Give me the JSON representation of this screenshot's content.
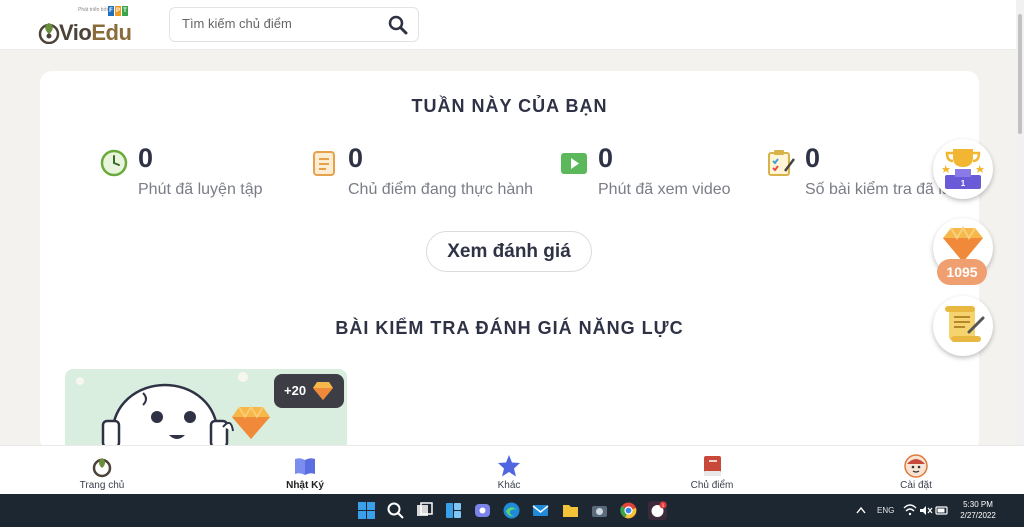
{
  "header": {
    "logo_sponsor": "Phát triển bởi",
    "logo_fpt": [
      "F",
      "P",
      "T"
    ],
    "logo_text_a": "Vio",
    "logo_text_b": "Edu",
    "search_placeholder": "Tìm kiếm chủ điểm"
  },
  "weekly": {
    "title": "TUẦN NÀY CỦA BẠN",
    "stats": [
      {
        "value": "0",
        "label": "Phút đã luyện tập",
        "icon": "clock-icon"
      },
      {
        "value": "0",
        "label": "Chủ điểm đang thực hành",
        "icon": "document-icon"
      },
      {
        "value": "0",
        "label": "Phút đã xem video",
        "icon": "play-icon"
      },
      {
        "value": "0",
        "label": "Số bài kiểm tra đã làm",
        "icon": "checklist-icon"
      }
    ],
    "review_button": "Xem đánh giá"
  },
  "assessment": {
    "title": "BÀI KIỂM TRA ĐÁNH GIÁ NĂNG LỰC",
    "reward": "+20"
  },
  "floating": {
    "gem_count": "1095"
  },
  "bottom_nav": {
    "items": [
      {
        "label": "Trang chủ",
        "icon": "home-sprout-icon"
      },
      {
        "label": "Nhật Ký",
        "icon": "book-open-icon",
        "active": true
      },
      {
        "label": "Khác",
        "icon": "star-icon"
      },
      {
        "label": "Chủ điểm",
        "icon": "book-icon"
      },
      {
        "label": "Cài đặt",
        "icon": "avatar-settings-icon"
      }
    ]
  },
  "taskbar": {
    "lang": "ENG",
    "time": "5:30 PM",
    "date": "2/27/2022",
    "notification_count": "1"
  },
  "colors": {
    "accent_brown": "#8a6c3b",
    "title_text": "#2e3244",
    "muted_text": "#7a7d86",
    "gem_orange": "#f0a070",
    "nav_purple": "#5b6ee1",
    "taskbar": "#1d2732"
  }
}
